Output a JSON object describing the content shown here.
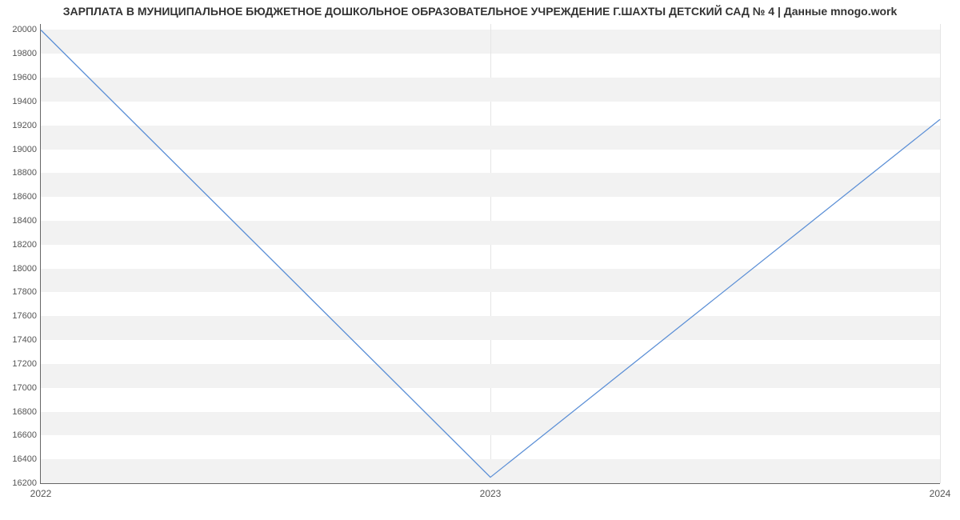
{
  "chart_data": {
    "type": "line",
    "title": "ЗАРПЛАТА В МУНИЦИПАЛЬНОЕ БЮДЖЕТНОЕ ДОШКОЛЬНОЕ ОБРАЗОВАТЕЛЬНОЕ УЧРЕЖДЕНИЕ Г.ШАХТЫ ДЕТСКИЙ САД № 4 | Данные mnogo.work",
    "x": [
      2022,
      2023,
      2024
    ],
    "values": [
      20000,
      16250,
      19250
    ],
    "xticks": [
      2022,
      2023,
      2024
    ],
    "yticks": [
      16200,
      16400,
      16600,
      16800,
      17000,
      17200,
      17400,
      17600,
      17800,
      18000,
      18200,
      18400,
      18600,
      18800,
      19000,
      19200,
      19400,
      19600,
      19800,
      20000
    ],
    "xlim": [
      2022,
      2024
    ],
    "ylim": [
      16200,
      20050
    ],
    "xlabel": "",
    "ylabel": ""
  }
}
